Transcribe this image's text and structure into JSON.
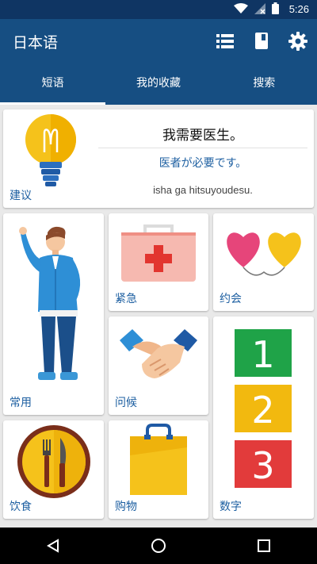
{
  "status_bar": {
    "time": "5:26",
    "icons": [
      "wifi-icon",
      "signal-icon",
      "battery-icon"
    ]
  },
  "app_bar": {
    "title": "日本语",
    "actions": [
      "list-icon",
      "book-icon",
      "settings-icon"
    ]
  },
  "tabs": [
    {
      "label": "短语",
      "active": true
    },
    {
      "label": "我的收藏",
      "active": false
    },
    {
      "label": "搜索",
      "active": false
    }
  ],
  "suggestion": {
    "label": "建议",
    "phrase_zh": "我需要医生。",
    "phrase_jp": "医者が必要です。",
    "romaji": "isha ga hitsuyoudesu."
  },
  "categories": [
    {
      "label": "常用",
      "icon": "man-icon"
    },
    {
      "label": "紧急",
      "icon": "first-aid-kit-icon"
    },
    {
      "label": "约会",
      "icon": "heart-balloons-icon"
    },
    {
      "label": "问候",
      "icon": "handshake-icon"
    },
    {
      "label": "数字",
      "icon": "numbers-icon",
      "digits": [
        "1",
        "2",
        "3"
      ]
    },
    {
      "label": "饮食",
      "icon": "fork-knife-plate-icon"
    },
    {
      "label": "购物",
      "icon": "shopping-bag-icon"
    }
  ],
  "colors": {
    "status_bar": "#0f3563",
    "app_bar": "#164e82",
    "label_blue": "#1d5fa1",
    "number_green": "#1fa348",
    "number_yellow": "#f2b90f",
    "number_red": "#e23b3b"
  }
}
